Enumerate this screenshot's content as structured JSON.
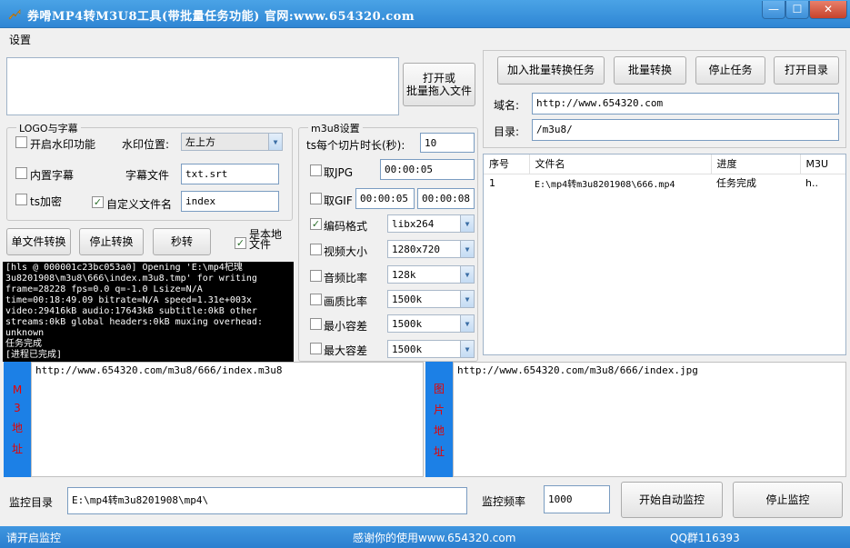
{
  "window": {
    "title": "券嗗MP4转M3U8工具(带批量任务功能)  官网:www.654320.com",
    "min_glyph": "—",
    "max_glyph": "☐",
    "close_glyph": "✕"
  },
  "menu": {
    "settings": "设置"
  },
  "left_top": {
    "open_button": "打开或\n批量拖入文件",
    "path_value": ""
  },
  "logo_group": {
    "title": "LOGO与字幕",
    "watermark_enable": "开启水印功能",
    "watermark_pos_label": "水印位置:",
    "watermark_pos_value": "左上方",
    "embed_subtitle": "内置字幕",
    "subtitle_file_label": "字幕文件",
    "subtitle_file_value": "txt.srt",
    "ts_encrypt": "ts加密",
    "custom_filename": "自定义文件名",
    "custom_filename_value": "index"
  },
  "actions": {
    "single_convert": "单文件转换",
    "stop_convert": "停止转换",
    "seconds_convert": "秒转",
    "is_local_file": "是本地\n文件"
  },
  "log_text": "[hls @ 000001c23bc053a0] Opening 'E:\\mp4杞瑰\n3u8201908\\m3u8\\666\\index.m3u8.tmp' for writing\nframe=28228 fps=0.0 q=-1.0 Lsize=N/A\ntime=00:18:49.09 bitrate=N/A speed=1.31e+003x\nvideo:29416kB audio:17643kB subtitle:0kB other\nstreams:0kB global headers:0kB muxing overhead:\nunknown\n任务完成\n[进程已完成]",
  "m3u8_group": {
    "title": "m3u8设置",
    "seg_label": "ts每个切片时长(秒):",
    "seg_value": "10",
    "jpg_label": "取JPG",
    "jpg_time": "00:00:05",
    "gif_label": "取GIF",
    "gif_start": "00:00:05",
    "gif_end": "00:00:08",
    "codec_label": "编码格式",
    "codec_value": "libx264",
    "size_label": "视频大小",
    "size_value": "1280x720",
    "abitrate_label": "音频比率",
    "abitrate_value": "128k",
    "quality_label": "画质比率",
    "quality_value": "1500k",
    "minbuf_label": "最小容差",
    "minbuf_value": "1500k",
    "maxbuf_label": "最大容差",
    "maxbuf_value": "1500k"
  },
  "right_panel": {
    "add_batch": "加入批量转换任务",
    "batch_convert": "批量转换",
    "stop_task": "停止任务",
    "open_dir": "打开目录",
    "domain_label": "域名:",
    "domain_value": "http://www.654320.com",
    "dir_label": "目录:",
    "dir_value": "/m3u8/"
  },
  "task_table": {
    "headers": [
      "序号",
      "文件名",
      "进度",
      "M3U"
    ],
    "rows": [
      [
        "1",
        "E:\\mp4转m3u8201908\\666.mp4",
        "任务完成",
        "h.."
      ]
    ]
  },
  "m3_address": {
    "label_chars": [
      "M",
      "3",
      "地",
      "址"
    ],
    "value": "http://www.654320.com/m3u8/666/index.m3u8"
  },
  "img_address": {
    "label_chars": [
      "图",
      "片",
      "地",
      "址"
    ],
    "value": "http://www.654320.com/m3u8/666/index.jpg"
  },
  "monitor": {
    "dir_label": "监控目录",
    "dir_value": "E:\\mp4转m3u8201908\\mp4\\",
    "freq_label": "监控频率",
    "freq_value": "1000",
    "start_button": "开始自动监控",
    "stop_button": "停止监控"
  },
  "status": {
    "left": "请开启监控",
    "center": "感谢你的使用www.654320.com",
    "right": "QQ群116393"
  },
  "checkbox_states": {
    "watermark": false,
    "embed_subtitle": false,
    "ts_encrypt": false,
    "custom_filename": true,
    "is_local": true,
    "jpg": false,
    "gif": false,
    "codec": true,
    "size": false,
    "abitrate": false,
    "quality": false,
    "minbuf": false,
    "maxbuf": false
  },
  "colors": {
    "titlebar": "#2f86d4",
    "vbar": "#1c80e6",
    "vbar_text": "#e60000",
    "status": "#2b7fcf"
  }
}
